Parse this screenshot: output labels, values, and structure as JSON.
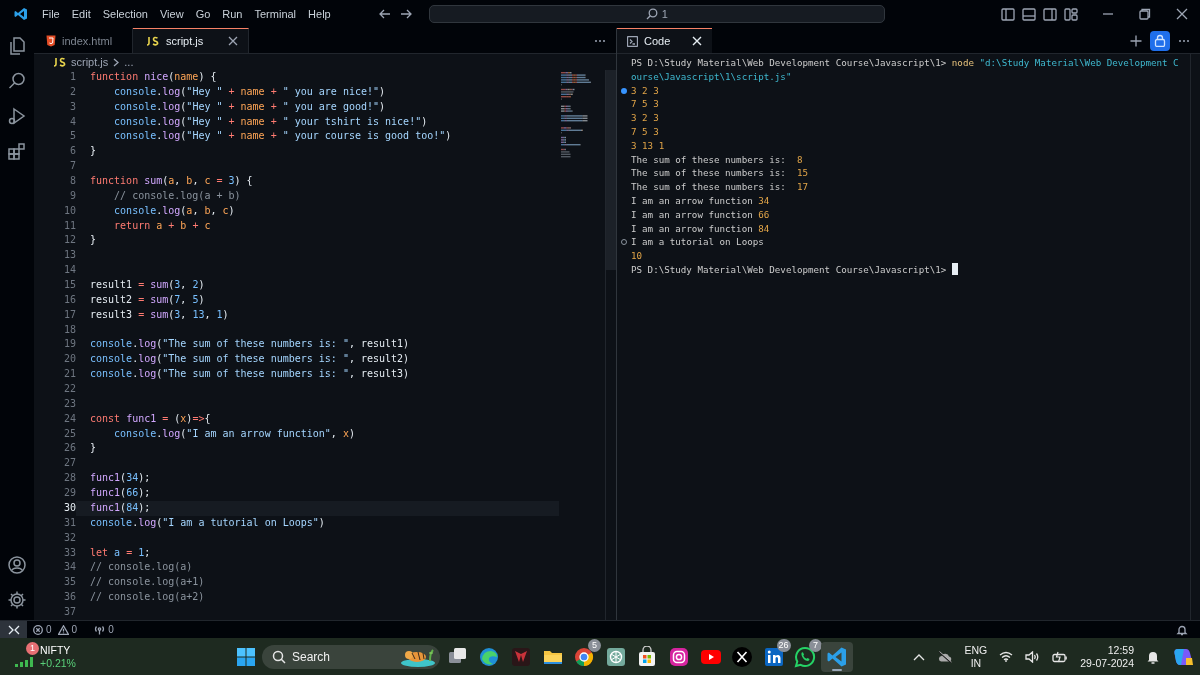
{
  "title_bar": {
    "menu": [
      "File",
      "Edit",
      "Selection",
      "View",
      "Go",
      "Run",
      "Terminal",
      "Help"
    ],
    "command_center": "1"
  },
  "editor": {
    "tabs": [
      {
        "label": "index.html",
        "selected": false
      },
      {
        "label": "script.js",
        "selected": true
      }
    ],
    "breadcrumb": [
      "script.js",
      "..."
    ],
    "lines": [
      {
        "number": "1",
        "current": false,
        "tokens": [
          {
            "kind": "keyword",
            "text": "function "
          },
          {
            "kind": "function",
            "text": "nice"
          },
          {
            "kind": "punct",
            "text": "("
          },
          {
            "kind": "param",
            "text": "name"
          },
          {
            "kind": "punct",
            "text": ") {"
          }
        ]
      },
      {
        "number": "2",
        "current": false,
        "tokens": [
          {
            "kind": "variable",
            "text": "    console"
          },
          {
            "kind": "punct",
            "text": "."
          },
          {
            "kind": "function",
            "text": "log"
          },
          {
            "kind": "punct",
            "text": "("
          },
          {
            "kind": "string",
            "text": "\"Hey \""
          },
          {
            "kind": "operator",
            "text": " + "
          },
          {
            "kind": "param",
            "text": "name"
          },
          {
            "kind": "operator",
            "text": " + "
          },
          {
            "kind": "string",
            "text": "\" you are nice!\""
          },
          {
            "kind": "punct",
            "text": ")"
          }
        ]
      },
      {
        "number": "3",
        "current": false,
        "tokens": [
          {
            "kind": "variable",
            "text": "    console"
          },
          {
            "kind": "punct",
            "text": "."
          },
          {
            "kind": "function",
            "text": "log"
          },
          {
            "kind": "punct",
            "text": "("
          },
          {
            "kind": "string",
            "text": "\"Hey \""
          },
          {
            "kind": "operator",
            "text": " + "
          },
          {
            "kind": "param",
            "text": "name"
          },
          {
            "kind": "operator",
            "text": " + "
          },
          {
            "kind": "string",
            "text": "\" you are good!\""
          },
          {
            "kind": "punct",
            "text": ")"
          }
        ]
      },
      {
        "number": "4",
        "current": false,
        "tokens": [
          {
            "kind": "variable",
            "text": "    console"
          },
          {
            "kind": "punct",
            "text": "."
          },
          {
            "kind": "function",
            "text": "log"
          },
          {
            "kind": "punct",
            "text": "("
          },
          {
            "kind": "string",
            "text": "\"Hey \""
          },
          {
            "kind": "operator",
            "text": " + "
          },
          {
            "kind": "param",
            "text": "name"
          },
          {
            "kind": "operator",
            "text": " + "
          },
          {
            "kind": "string",
            "text": "\" your tshirt is nice!\""
          },
          {
            "kind": "punct",
            "text": ")"
          }
        ]
      },
      {
        "number": "5",
        "current": false,
        "tokens": [
          {
            "kind": "variable",
            "text": "    console"
          },
          {
            "kind": "punct",
            "text": "."
          },
          {
            "kind": "function",
            "text": "log"
          },
          {
            "kind": "punct",
            "text": "("
          },
          {
            "kind": "string",
            "text": "\"Hey \""
          },
          {
            "kind": "operator",
            "text": " + "
          },
          {
            "kind": "param",
            "text": "name"
          },
          {
            "kind": "operator",
            "text": " + "
          },
          {
            "kind": "string",
            "text": "\" your course is good too!\""
          },
          {
            "kind": "punct",
            "text": ")"
          }
        ]
      },
      {
        "number": "6",
        "current": false,
        "tokens": [
          {
            "kind": "punct",
            "text": "}"
          }
        ]
      },
      {
        "number": "7",
        "current": false
      },
      {
        "number": "8",
        "current": false,
        "tokens": [
          {
            "kind": "keyword",
            "text": "function "
          },
          {
            "kind": "function",
            "text": "sum"
          },
          {
            "kind": "punct",
            "text": "("
          },
          {
            "kind": "param",
            "text": "a"
          },
          {
            "kind": "punct",
            "text": ", "
          },
          {
            "kind": "param",
            "text": "b"
          },
          {
            "kind": "punct",
            "text": ", "
          },
          {
            "kind": "param",
            "text": "c"
          },
          {
            "kind": "operator",
            "text": " = "
          },
          {
            "kind": "number",
            "text": "3"
          },
          {
            "kind": "punct",
            "text": ") {"
          }
        ]
      },
      {
        "number": "9",
        "current": false,
        "tokens": [
          {
            "kind": "comment",
            "text": "    // console.log(a + b)"
          }
        ]
      },
      {
        "number": "10",
        "current": false,
        "tokens": [
          {
            "kind": "variable",
            "text": "    console"
          },
          {
            "kind": "punct",
            "text": "."
          },
          {
            "kind": "function",
            "text": "log"
          },
          {
            "kind": "punct",
            "text": "("
          },
          {
            "kind": "param",
            "text": "a"
          },
          {
            "kind": "punct",
            "text": ", "
          },
          {
            "kind": "param",
            "text": "b"
          },
          {
            "kind": "punct",
            "text": ", "
          },
          {
            "kind": "param",
            "text": "c"
          },
          {
            "kind": "punct",
            "text": ")"
          }
        ]
      },
      {
        "number": "11",
        "current": false,
        "tokens": [
          {
            "kind": "keyword",
            "text": "    return "
          },
          {
            "kind": "param",
            "text": "a"
          },
          {
            "kind": "operator",
            "text": " + "
          },
          {
            "kind": "param",
            "text": "b"
          },
          {
            "kind": "operator",
            "text": " + "
          },
          {
            "kind": "param",
            "text": "c"
          }
        ]
      },
      {
        "number": "12",
        "current": false,
        "tokens": [
          {
            "kind": "punct",
            "text": "}"
          }
        ]
      },
      {
        "number": "13",
        "current": false
      },
      {
        "number": "14",
        "current": false
      },
      {
        "number": "15",
        "current": false,
        "tokens": [
          {
            "kind": "punct",
            "text": "result1"
          },
          {
            "kind": "operator",
            "text": " = "
          },
          {
            "kind": "function",
            "text": "sum"
          },
          {
            "kind": "punct",
            "text": "("
          },
          {
            "kind": "number",
            "text": "3"
          },
          {
            "kind": "punct",
            "text": ", "
          },
          {
            "kind": "number",
            "text": "2"
          },
          {
            "kind": "punct",
            "text": ")"
          }
        ]
      },
      {
        "number": "16",
        "current": false,
        "tokens": [
          {
            "kind": "punct",
            "text": "result2"
          },
          {
            "kind": "operator",
            "text": " = "
          },
          {
            "kind": "function",
            "text": "sum"
          },
          {
            "kind": "punct",
            "text": "("
          },
          {
            "kind": "number",
            "text": "7"
          },
          {
            "kind": "punct",
            "text": ", "
          },
          {
            "kind": "number",
            "text": "5"
          },
          {
            "kind": "punct",
            "text": ")"
          }
        ]
      },
      {
        "number": "17",
        "current": false,
        "tokens": [
          {
            "kind": "punct",
            "text": "result3"
          },
          {
            "kind": "operator",
            "text": " = "
          },
          {
            "kind": "function",
            "text": "sum"
          },
          {
            "kind": "punct",
            "text": "("
          },
          {
            "kind": "number",
            "text": "3"
          },
          {
            "kind": "punct",
            "text": ", "
          },
          {
            "kind": "number",
            "text": "13"
          },
          {
            "kind": "punct",
            "text": ", "
          },
          {
            "kind": "number",
            "text": "1"
          },
          {
            "kind": "punct",
            "text": ")"
          }
        ]
      },
      {
        "number": "18",
        "current": false
      },
      {
        "number": "19",
        "current": false,
        "tokens": [
          {
            "kind": "variable",
            "text": "console"
          },
          {
            "kind": "punct",
            "text": "."
          },
          {
            "kind": "function",
            "text": "log"
          },
          {
            "kind": "punct",
            "text": "("
          },
          {
            "kind": "string",
            "text": "\"The sum of these numbers is: \""
          },
          {
            "kind": "punct",
            "text": ", result1)"
          }
        ]
      },
      {
        "number": "20",
        "current": false,
        "tokens": [
          {
            "kind": "variable",
            "text": "console"
          },
          {
            "kind": "punct",
            "text": "."
          },
          {
            "kind": "function",
            "text": "log"
          },
          {
            "kind": "punct",
            "text": "("
          },
          {
            "kind": "string",
            "text": "\"The sum of these numbers is: \""
          },
          {
            "kind": "punct",
            "text": ", result2)"
          }
        ]
      },
      {
        "number": "21",
        "current": false,
        "tokens": [
          {
            "kind": "variable",
            "text": "console"
          },
          {
            "kind": "punct",
            "text": "."
          },
          {
            "kind": "function",
            "text": "log"
          },
          {
            "kind": "punct",
            "text": "("
          },
          {
            "kind": "string",
            "text": "\"The sum of these numbers is: \""
          },
          {
            "kind": "punct",
            "text": ", result3)"
          }
        ]
      },
      {
        "number": "22",
        "current": false
      },
      {
        "number": "23",
        "current": false
      },
      {
        "number": "24",
        "current": false,
        "tokens": [
          {
            "kind": "keyword",
            "text": "const "
          },
          {
            "kind": "function",
            "text": "func1"
          },
          {
            "kind": "operator",
            "text": " = "
          },
          {
            "kind": "punct",
            "text": "("
          },
          {
            "kind": "param",
            "text": "x"
          },
          {
            "kind": "punct",
            "text": ")"
          },
          {
            "kind": "keyword",
            "text": "=>"
          },
          {
            "kind": "punct",
            "text": "{"
          }
        ]
      },
      {
        "number": "25",
        "current": false,
        "tokens": [
          {
            "kind": "variable",
            "text": "    console"
          },
          {
            "kind": "punct",
            "text": "."
          },
          {
            "kind": "function",
            "text": "log"
          },
          {
            "kind": "punct",
            "text": "("
          },
          {
            "kind": "string",
            "text": "\"I am an arrow function\""
          },
          {
            "kind": "punct",
            "text": ", "
          },
          {
            "kind": "param",
            "text": "x"
          },
          {
            "kind": "punct",
            "text": ")"
          }
        ]
      },
      {
        "number": "26",
        "current": false,
        "tokens": [
          {
            "kind": "punct",
            "text": "}"
          }
        ]
      },
      {
        "number": "27",
        "current": false
      },
      {
        "number": "28",
        "current": false,
        "tokens": [
          {
            "kind": "function",
            "text": "func1"
          },
          {
            "kind": "punct",
            "text": "("
          },
          {
            "kind": "number",
            "text": "34"
          },
          {
            "kind": "punct",
            "text": ");"
          }
        ]
      },
      {
        "number": "29",
        "current": false,
        "tokens": [
          {
            "kind": "function",
            "text": "func1"
          },
          {
            "kind": "punct",
            "text": "("
          },
          {
            "kind": "number",
            "text": "66"
          },
          {
            "kind": "punct",
            "text": ");"
          }
        ]
      },
      {
        "number": "30",
        "current": true,
        "tokens": [
          {
            "kind": "function",
            "text": "func1"
          },
          {
            "kind": "punct",
            "text": "("
          },
          {
            "kind": "number",
            "text": "84"
          },
          {
            "kind": "punct",
            "text": ");"
          }
        ]
      },
      {
        "number": "31",
        "current": false,
        "tokens": [
          {
            "kind": "variable",
            "text": "console"
          },
          {
            "kind": "punct",
            "text": "."
          },
          {
            "kind": "function",
            "text": "log"
          },
          {
            "kind": "punct",
            "text": "("
          },
          {
            "kind": "string",
            "text": "\"I am a tutorial on Loops\""
          },
          {
            "kind": "punct",
            "text": ")"
          }
        ]
      },
      {
        "number": "32",
        "current": false
      },
      {
        "number": "33",
        "current": false,
        "tokens": [
          {
            "kind": "keyword",
            "text": "let "
          },
          {
            "kind": "variable",
            "text": "a"
          },
          {
            "kind": "operator",
            "text": " = "
          },
          {
            "kind": "number",
            "text": "1"
          },
          {
            "kind": "punct",
            "text": ";"
          }
        ]
      },
      {
        "number": "34",
        "current": false,
        "tokens": [
          {
            "kind": "comment",
            "text": "// console.log(a)"
          }
        ]
      },
      {
        "number": "35",
        "current": false,
        "tokens": [
          {
            "kind": "comment",
            "text": "// console.log(a+1)"
          }
        ]
      },
      {
        "number": "36",
        "current": false,
        "tokens": [
          {
            "kind": "comment",
            "text": "// console.log(a+2)"
          }
        ]
      },
      {
        "number": "37",
        "current": false
      }
    ]
  },
  "terminal": {
    "tab": "Code",
    "lines": [
      {
        "tokens": [
          {
            "kind": "plain",
            "text": "PS D:\\Study Material\\Web Development Course\\Javascript\\1> "
          },
          {
            "kind": "command",
            "text": "node "
          },
          {
            "kind": "string",
            "text": "\"d:\\Study Material\\Web Development Course\\Javascript\\1\\script.js\""
          }
        ]
      },
      {
        "succeeded": true,
        "tokens": [
          {
            "kind": "number",
            "text": "3 2 3"
          }
        ]
      },
      {
        "tokens": [
          {
            "kind": "number",
            "text": "7 5 3"
          }
        ]
      },
      {
        "tokens": [
          {
            "kind": "number",
            "text": "3 2 3"
          }
        ]
      },
      {
        "tokens": [
          {
            "kind": "number",
            "text": "7 5 3"
          }
        ]
      },
      {
        "tokens": [
          {
            "kind": "number",
            "text": "3 13 1"
          }
        ]
      },
      {
        "tokens": [
          {
            "kind": "plain",
            "text": "The sum of these numbers is:  "
          },
          {
            "kind": "number",
            "text": "8"
          }
        ]
      },
      {
        "tokens": [
          {
            "kind": "plain",
            "text": "The sum of these numbers is:  "
          },
          {
            "kind": "number",
            "text": "15"
          }
        ]
      },
      {
        "tokens": [
          {
            "kind": "plain",
            "text": "The sum of these numbers is:  "
          },
          {
            "kind": "number",
            "text": "17"
          }
        ]
      },
      {
        "tokens": [
          {
            "kind": "plain",
            "text": "I am an arrow function "
          },
          {
            "kind": "number",
            "text": "34"
          }
        ]
      },
      {
        "tokens": [
          {
            "kind": "plain",
            "text": "I am an arrow function "
          },
          {
            "kind": "number",
            "text": "66"
          }
        ]
      },
      {
        "tokens": [
          {
            "kind": "plain",
            "text": "I am an arrow function "
          },
          {
            "kind": "number",
            "text": "84"
          }
        ]
      },
      {
        "succeeded": false,
        "tokens": [
          {
            "kind": "plain",
            "text": "I am a tutorial on Loops"
          }
        ]
      },
      {
        "tokens": [
          {
            "kind": "number",
            "text": "10"
          }
        ]
      },
      {
        "cursor": true,
        "tokens": [
          {
            "kind": "plain",
            "text": "PS D:\\Study Material\\Web Development Course\\Javascript\\1> "
          }
        ]
      }
    ]
  },
  "status_bar": {
    "errors": "0",
    "warnings": "0",
    "ports": "0"
  },
  "taskbar": {
    "widget": {
      "badge": "1",
      "name": "NIFTY",
      "change": "+0.21%"
    },
    "search": {
      "label": "Search"
    },
    "apps": [
      {
        "selected": false
      },
      {
        "selected": false
      },
      {
        "selected": false
      },
      {
        "selected": false
      },
      {
        "selected": false,
        "badge": "5"
      },
      {
        "selected": false
      },
      {
        "selected": false
      },
      {
        "selected": false
      },
      {
        "selected": false
      },
      {
        "selected": false
      },
      {
        "selected": false,
        "badge": "26"
      },
      {
        "selected": false,
        "badge": "7"
      },
      {
        "selected": true
      }
    ],
    "tray": {
      "language": "ENG",
      "region": "IN",
      "time": "12:59",
      "date": "29-07-2024"
    }
  }
}
